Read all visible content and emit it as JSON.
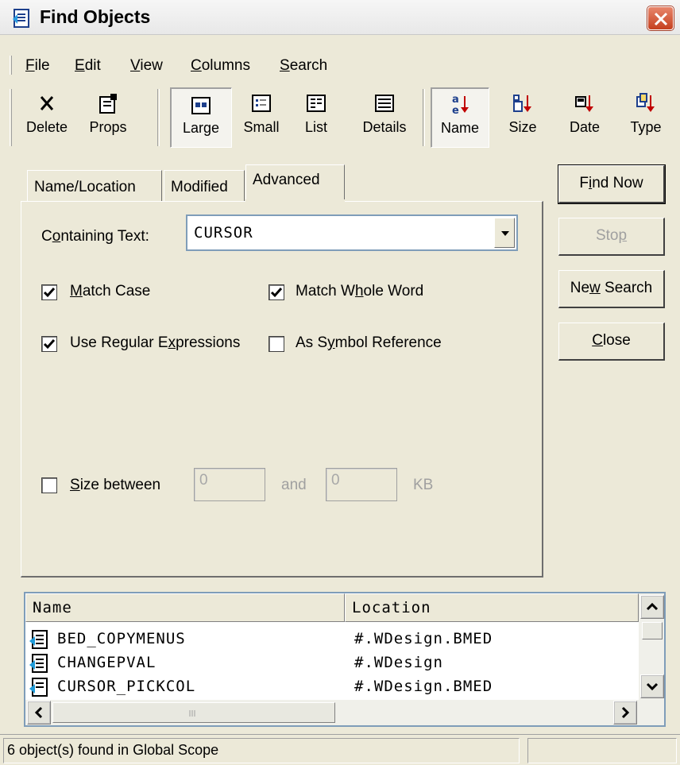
{
  "window": {
    "title": "Find Objects",
    "close_icon": "close-icon"
  },
  "menu": {
    "items": [
      {
        "label": "File",
        "mnemonic": "F",
        "rest": "ile"
      },
      {
        "label": "Edit",
        "mnemonic": "E",
        "rest": "dit"
      },
      {
        "label": "View",
        "mnemonic": "V",
        "rest": "iew"
      },
      {
        "label": "Columns",
        "mnemonic": "C",
        "rest": "olumns"
      },
      {
        "label": "Search",
        "mnemonic": "S",
        "rest": "earch"
      }
    ]
  },
  "toolbar": {
    "delete": "Delete",
    "props": "Props",
    "large": "Large",
    "small": "Small",
    "list": "List",
    "details": "Details",
    "name": "Name",
    "size": "Size",
    "date": "Date",
    "type": "Type"
  },
  "tabs": [
    "Name/Location",
    "Modified",
    "Advanced"
  ],
  "advanced": {
    "containing_text_label_pre": "C",
    "containing_text_label_u": "o",
    "containing_text_label_post": "ntaining Text:",
    "containing_text_value": "CURSOR",
    "match_case": {
      "u": "M",
      "rest": "atch Case",
      "checked": true
    },
    "match_whole_word": {
      "pre": "Match W",
      "u": "h",
      "post": "ole Word",
      "checked": true
    },
    "use_regex": {
      "pre": "Use Regular E",
      "u": "x",
      "post": "pressions",
      "checked": true
    },
    "as_symbol": {
      "pre": "As S",
      "u": "y",
      "post": "mbol Reference",
      "checked": false
    },
    "size_between": {
      "u": "S",
      "rest": "ize between",
      "checked": false
    },
    "size_min": "0",
    "and_label": "and",
    "size_max": "0",
    "unit": "KB"
  },
  "buttons": {
    "find_now": {
      "pre": "F",
      "u": "i",
      "post": "nd Now"
    },
    "stop": {
      "pre": "Sto",
      "u": "p",
      "post": ""
    },
    "new_search": {
      "pre": "Ne",
      "u": "w",
      "post": " Search"
    },
    "close": {
      "pre": "",
      "u": "C",
      "post": "lose"
    }
  },
  "results": {
    "columns": [
      "Name",
      "Location"
    ],
    "rows": [
      {
        "name": "BED_COPYMENUS",
        "location": "#.WDesign.BMED"
      },
      {
        "name": "CHANGEPVAL",
        "location": "#.WDesign"
      },
      {
        "name": "CURSOR_PICKCOL",
        "location": "#.WDesign.BMED"
      }
    ]
  },
  "status": {
    "text": "6 object(s) found in Global Scope"
  }
}
